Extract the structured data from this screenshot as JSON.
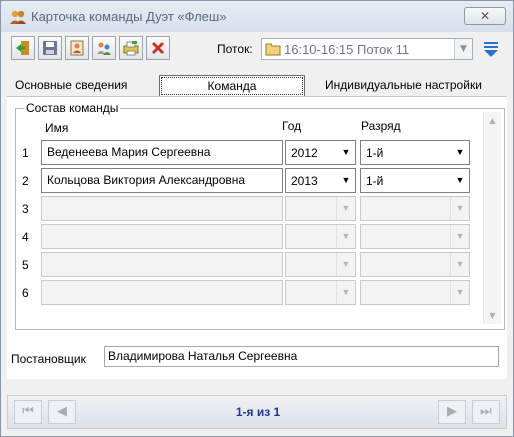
{
  "window": {
    "title": "Карточка команды Дуэт «Флеш»",
    "close_label": "✕"
  },
  "toolbar": {
    "buttons": [
      "exit",
      "save",
      "card",
      "users",
      "print",
      "delete"
    ],
    "potok_label": "Поток:",
    "potok_value": "16:10-16:15 Поток 11"
  },
  "tabs": [
    {
      "label": "Основные сведения"
    },
    {
      "label": "Команда"
    },
    {
      "label": "Индивидуальные настройки"
    }
  ],
  "team": {
    "group_title": "Состав команды",
    "headers": {
      "name": "Имя",
      "year": "Год",
      "rank": "Разряд"
    },
    "rows": [
      {
        "num": "1",
        "name": "Веденеева Мария Сергеевна",
        "year": "2012",
        "rank": "1-й"
      },
      {
        "num": "2",
        "name": "Кольцова Виктория Александровна",
        "year": "2013",
        "rank": "1-й"
      },
      {
        "num": "3",
        "name": "",
        "year": "",
        "rank": ""
      },
      {
        "num": "4",
        "name": "",
        "year": "",
        "rank": ""
      },
      {
        "num": "5",
        "name": "",
        "year": "",
        "rank": ""
      },
      {
        "num": "6",
        "name": "",
        "year": "",
        "rank": ""
      }
    ]
  },
  "producer": {
    "label": "Постановщик",
    "value": "Владимирова Наталья Сергеевна"
  },
  "navigator": {
    "text": "1-я из 1"
  }
}
